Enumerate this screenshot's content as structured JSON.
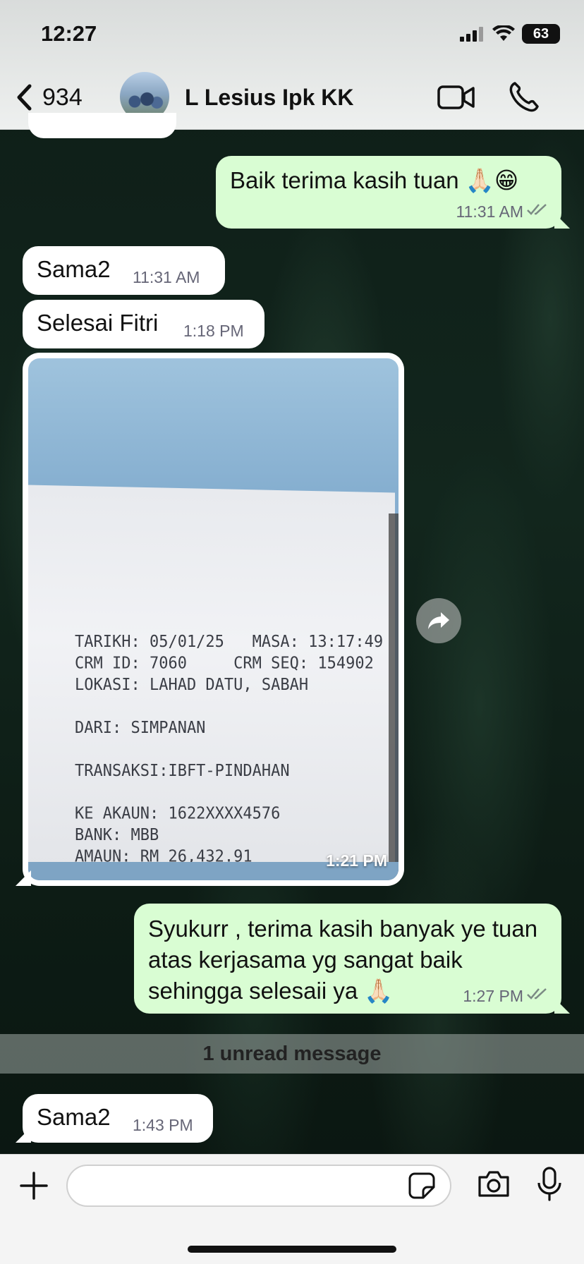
{
  "status_bar": {
    "time": "12:27",
    "battery": "63"
  },
  "header": {
    "back_count": "934",
    "contact_name": "L Lesius Ipk KK"
  },
  "messages": [
    {
      "direction": "out",
      "text": "Baik terima kasih tuan 🙏🏻😁",
      "time": "11:31 AM"
    },
    {
      "direction": "in",
      "text": "Sama2",
      "time": "11:31 AM"
    },
    {
      "direction": "in",
      "text": "Selesai Fitri",
      "time": "1:18 PM"
    },
    {
      "direction": "in",
      "type": "image",
      "time": "1:21 PM",
      "receipt_text": "TARIKH: 05/01/25   MASA: 13:17:49\nCRM ID: 7060     CRM SEQ: 154902\nLOKASI: LAHAD DATU, SABAH\n\nDARI: SIMPANAN\n\nTRANSAKSI:IBFT-PINDAHAN\n\nKE AKAUN: 1622XXXX4576\nBANK: MBB\nAMAUN: RM 26,432.91"
    },
    {
      "direction": "out",
      "text": "Syukurr , terima kasih banyak ye tuan atas kerjasama yg sangat baik sehingga selesaii ya 🙏🏻",
      "time": "1:27 PM"
    },
    {
      "direction": "in",
      "text": "Sama2",
      "time": "1:43 PM"
    }
  ],
  "unread_banner": "1 unread message",
  "input": {
    "value": "",
    "placeholder": ""
  },
  "colors": {
    "outgoing_bubble": "#d9fdd3",
    "incoming_bubble": "#ffffff",
    "header_bg": "#eef0ef"
  },
  "icons": [
    "back-chevron-icon",
    "video-call-icon",
    "phone-icon",
    "forward-icon",
    "plus-icon",
    "sticker-icon",
    "camera-icon",
    "microphone-icon",
    "read-ticks-icon"
  ]
}
